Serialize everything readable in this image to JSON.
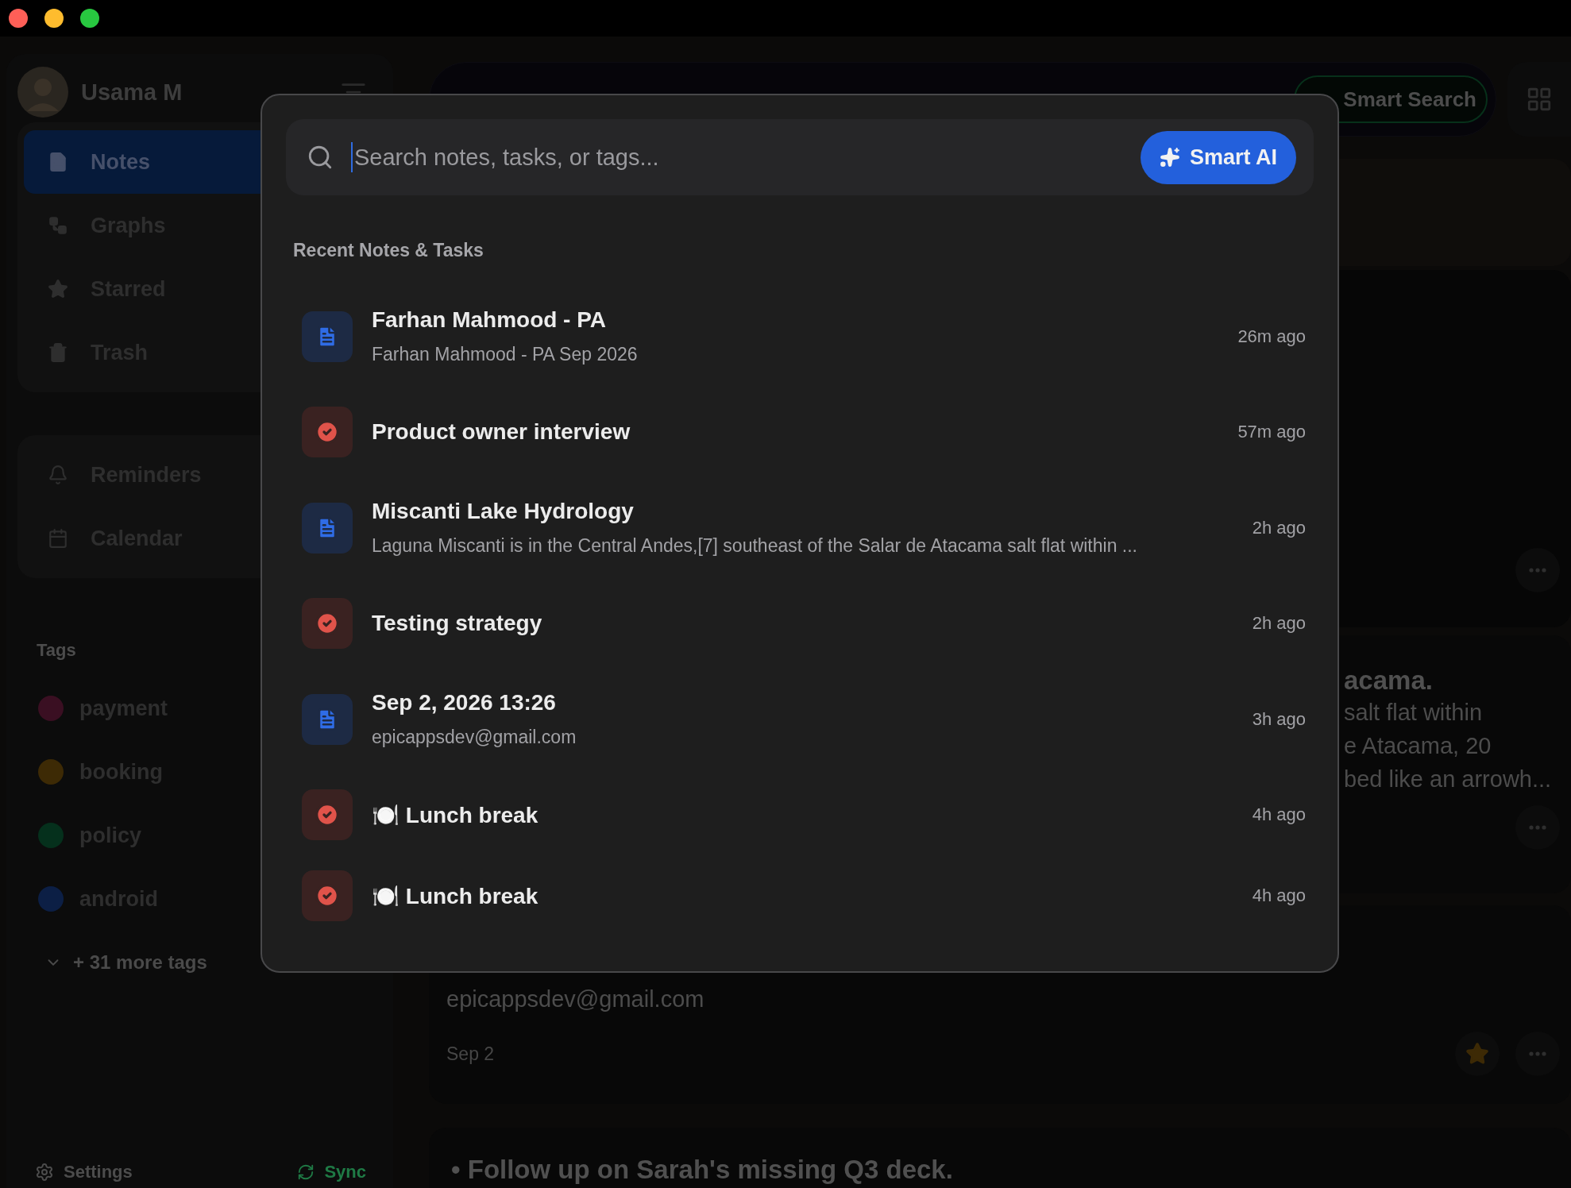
{
  "sidebar": {
    "user": {
      "name": "Usama M"
    },
    "nav": [
      {
        "label": "Notes",
        "selected": true
      },
      {
        "label": "Graphs",
        "selected": false
      },
      {
        "label": "Starred",
        "selected": false
      },
      {
        "label": "Trash",
        "selected": false
      }
    ],
    "secondary_nav": [
      {
        "label": "Reminders",
        "selected": false
      },
      {
        "label": "Calendar",
        "selected": false
      }
    ],
    "tags_heading": "Tags",
    "tags": [
      {
        "label": "payment",
        "color": "#3a0f22"
      },
      {
        "label": "booking",
        "color": "#3d2a05"
      },
      {
        "label": "policy",
        "color": "#05301c"
      },
      {
        "label": "android",
        "color": "#0c1f45"
      }
    ],
    "more_tags": "+ 31 more tags",
    "footer": {
      "settings": "Settings",
      "sync": "Sync"
    }
  },
  "toolbar": {
    "smart_search": "Smart Search"
  },
  "cards": [
    {
      "kind": "banner"
    },
    {
      "kind": "blank"
    },
    {
      "kind": "excerpt",
      "title": "acama.",
      "lines": [
        "salt flat within",
        "e Atacama, 20",
        "bed like an arrowh..."
      ]
    },
    {
      "kind": "note",
      "body": "epicappsdev@gmail.com",
      "date": "Sep 2",
      "starred": true
    },
    {
      "kind": "bullet",
      "text": "• Follow up on Sarah's missing Q3 deck."
    }
  ],
  "search_modal": {
    "placeholder": "Search notes, tasks, or tags...",
    "ai_button": "Smart AI",
    "section_title": "Recent Notes & Tasks",
    "items": [
      {
        "kind": "note",
        "title": "Farhan Mahmood - PA",
        "subtitle": "Farhan Mahmood - PA Sep 2026",
        "time": "26m ago"
      },
      {
        "kind": "task",
        "title": "Product owner interview",
        "time": "57m ago"
      },
      {
        "kind": "note",
        "title": "Miscanti Lake Hydrology",
        "subtitle": "Laguna Miscanti is in the Central Andes,[7] southeast of the Salar de Atacama salt flat within ...",
        "time": "2h ago"
      },
      {
        "kind": "task",
        "title": "Testing strategy",
        "time": "2h ago"
      },
      {
        "kind": "note",
        "title": "Sep 2, 2026 13:26",
        "subtitle": "epicappsdev@gmail.com",
        "time": "3h ago"
      },
      {
        "kind": "task",
        "title": "🍽️ Lunch break",
        "time": "4h ago"
      },
      {
        "kind": "task",
        "title": "🍽️ Lunch break",
        "time": "4h ago"
      }
    ]
  }
}
